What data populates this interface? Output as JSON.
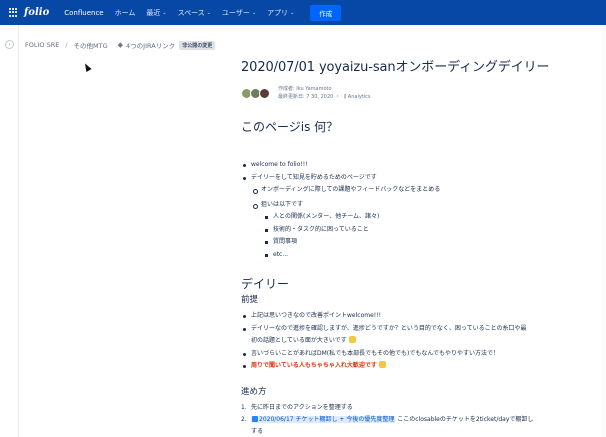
{
  "topnav": {
    "logo": "folio",
    "product": "Confluence",
    "items": [
      {
        "label": "ホーム",
        "has_menu": false
      },
      {
        "label": "最近",
        "has_menu": true
      },
      {
        "label": "スペース",
        "has_menu": true
      },
      {
        "label": "ユーザー",
        "has_menu": true
      },
      {
        "label": "アプリ",
        "has_menu": true
      }
    ],
    "create_label": "作成"
  },
  "breadcrumb": {
    "space": "FOLIO SRE",
    "parent": "その他MTG",
    "jira_links": "4つのJIRAリンク",
    "badge": "非公開の変更"
  },
  "page": {
    "title": "2020/07/01 yoyaizu-sanオンボーディングデイリー",
    "author_line": "作成者: Iku Yamamoto",
    "updated_line": "最終更新日: 7 30, 2020 ・",
    "analytics": "Analytics"
  },
  "section1": {
    "heading": "このページis 何？",
    "bullets": [
      {
        "level": 1,
        "text": "welcome to folio!!!"
      },
      {
        "level": 1,
        "text": "デイリーをして知見を貯めるためのページです"
      },
      {
        "level": 2,
        "text": "オンボーディングに際しての課題やフィードバックなどをまとめる"
      },
      {
        "level": 2,
        "text": "狙いは以下です"
      },
      {
        "level": 3,
        "text": "人との関係(メンター、他チーム、諸々)"
      },
      {
        "level": 3,
        "text": "技術的・タスク的に困っていること"
      },
      {
        "level": 3,
        "text": "質問事項"
      },
      {
        "level": 3,
        "text": "etc..."
      }
    ]
  },
  "section2": {
    "heading": "デイリー",
    "subheading": "前提",
    "bullets": [
      "上記は思いつきなので改善ポイントwelcome!!!",
      "デイリーなので進捗を確認しますが、進捗どうですか？という目的でなく、困っていることの糸口や最",
      "初の話題としている面が大きいです",
      "言いづらいことがあればDM(私でも本部長でもその他でも)でもなんでもやりやすい方法で！",
      "周りで聞いている人もちゃちゃ入れ大歓迎です"
    ],
    "method_heading": "進め方",
    "steps": [
      {
        "num": "1.",
        "text": "先に昨日までのアクションを整理する"
      },
      {
        "num": "2.",
        "link": "2020/06/17 チケット棚卸し + 今後の優先度整理",
        "text": "ここのclosableのチケットを2ticket/dayで棚卸し"
      }
    ],
    "step2_cont": "する"
  },
  "colors": {
    "nav_bg": "#0747a6",
    "create_button": "#0065ff",
    "warning_text": "#de350b",
    "link": "#0052cc"
  }
}
